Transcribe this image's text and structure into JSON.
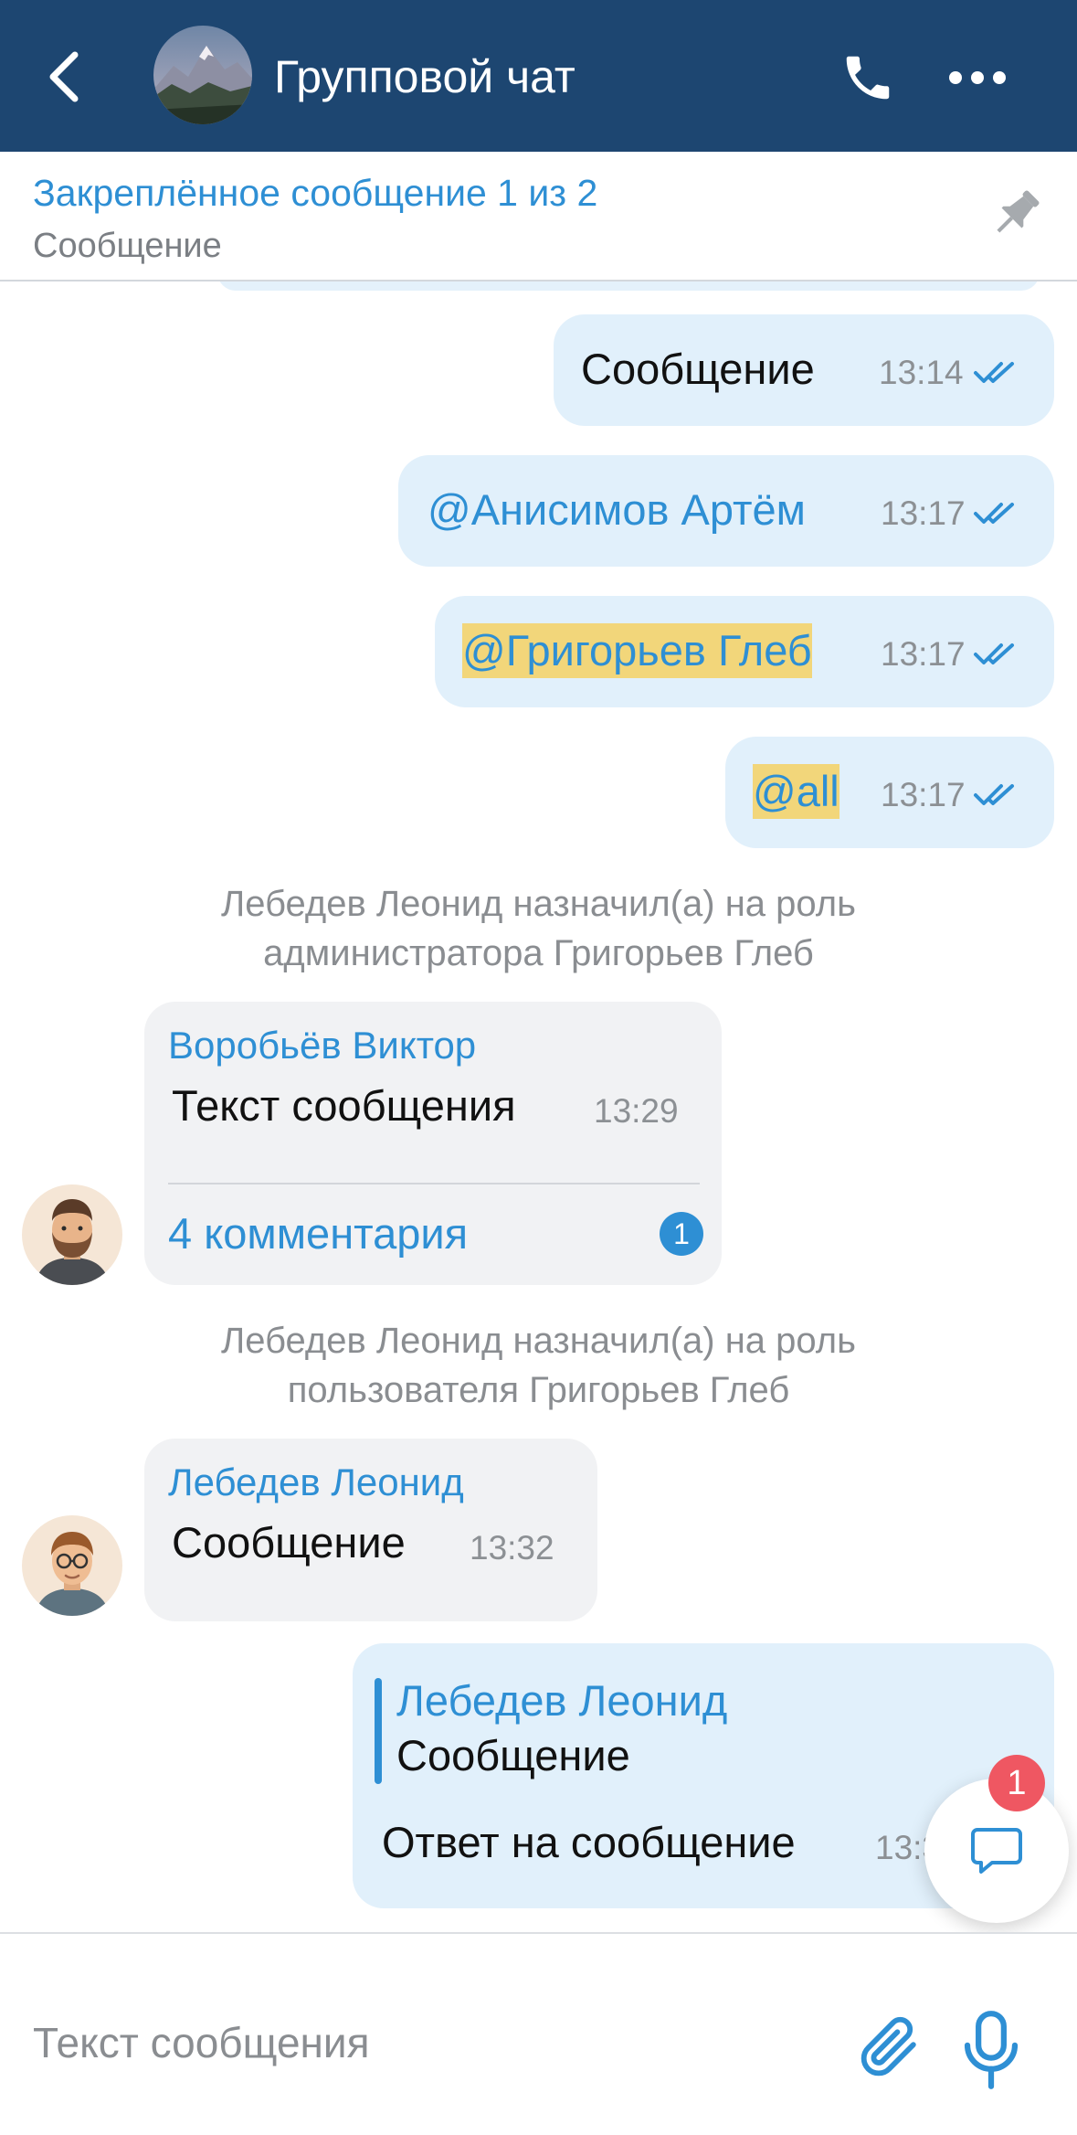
{
  "header": {
    "title": "Групповой чат",
    "back_icon": "chevron-left-icon",
    "call_icon": "phone-icon",
    "more_icon": "more-horizontal-icon",
    "background_color": "#1d4671"
  },
  "pinned": {
    "title": "Закреплённое сообщение 1 из 2",
    "text": "Сообщение",
    "icon": "pin-icon"
  },
  "messages": [
    {
      "type": "outgoing",
      "text": "Сообщение",
      "time": "13:14",
      "status": "read"
    },
    {
      "type": "outgoing",
      "text": "@Анисимов Артём",
      "time": "13:17",
      "status": "read",
      "mention": true
    },
    {
      "type": "outgoing",
      "text": "@Григорьев Глеб",
      "time": "13:17",
      "status": "read",
      "mention": true,
      "highlighted": true
    },
    {
      "type": "outgoing",
      "text": "@all",
      "time": "13:17",
      "status": "read",
      "mention": true,
      "highlighted": true
    },
    {
      "type": "system",
      "lines": [
        "Лебедев Леонид назначил(а) на роль",
        "администратора Григорьев Глеб"
      ]
    },
    {
      "type": "incoming",
      "sender": "Воробьёв Виктор",
      "text": "Текст сообщения",
      "time": "13:29",
      "comments": "4 комментария",
      "unread_comments": "1"
    },
    {
      "type": "system",
      "lines": [
        "Лебедев Леонид назначил(а) на роль",
        "пользователя Григорьев Глеб"
      ]
    },
    {
      "type": "incoming",
      "sender": "Лебедев Леонид",
      "text": "Сообщение",
      "time": "13:32"
    },
    {
      "type": "outgoing-reply",
      "quote_sender": "Лебедев Леонид",
      "quote_text": "Сообщение",
      "text": "Ответ на сообщение",
      "time": "13:3"
    }
  ],
  "comments_fab": {
    "badge": "1",
    "icon": "chat-bubble-icon"
  },
  "input": {
    "placeholder": "Текст сообщения",
    "value": ""
  },
  "colors": {
    "accent": "#2e8fd4",
    "outgoing_bubble": "#e1f0fb",
    "incoming_bubble": "#f1f2f4",
    "highlight": "#f2d67a",
    "badge_red": "#ef5762"
  }
}
